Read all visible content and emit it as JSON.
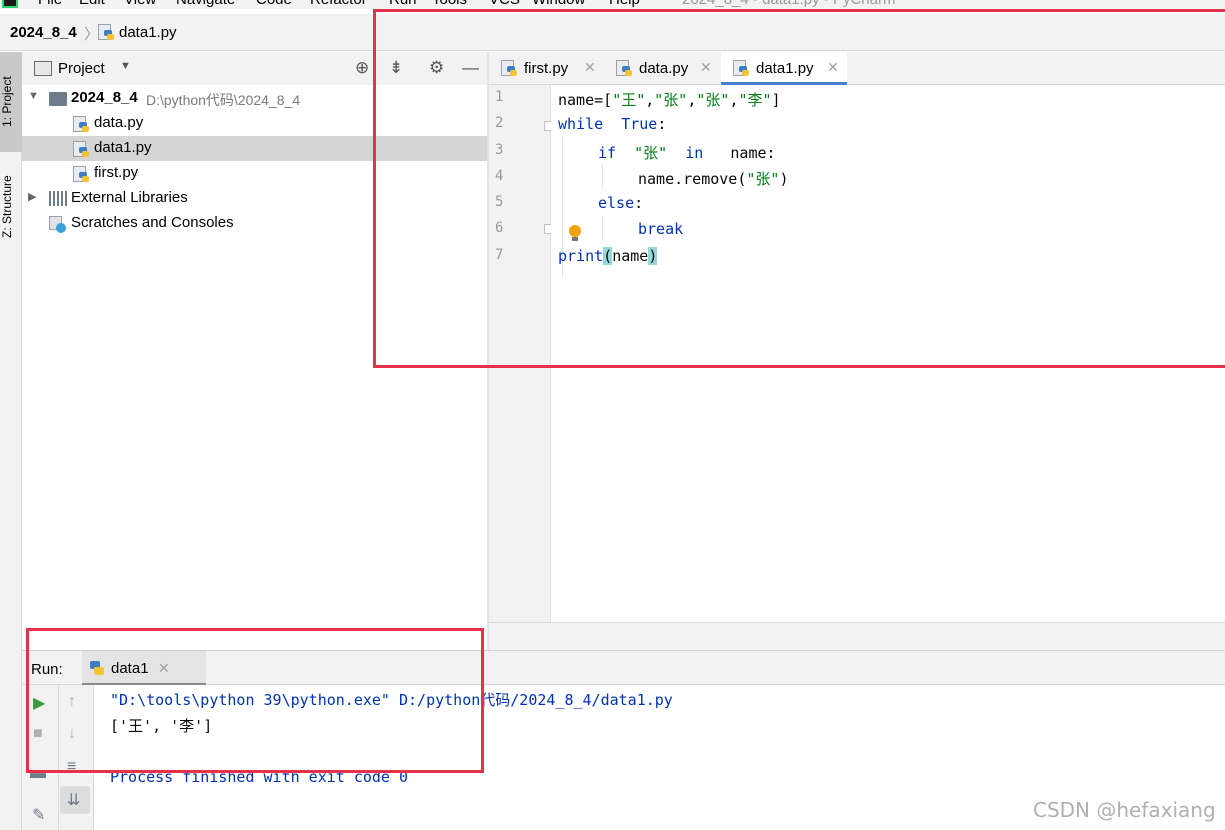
{
  "menu": {
    "items": [
      "File",
      "Edit",
      "View",
      "Navigate",
      "Code",
      "Refactor",
      "Run",
      "Tools",
      "VCS",
      "Window",
      "Help"
    ],
    "window_title": "2024_8_4 - data1.py - PyCharm"
  },
  "breadcrumb": {
    "project": "2024_8_4",
    "file": "data1.py"
  },
  "left_strip": {
    "project_tab": "1: Project",
    "structure_tab": "Z: Structure"
  },
  "project_panel": {
    "title": "Project",
    "root": {
      "name": "2024_8_4",
      "path": "D:\\python代码\\2024_8_4"
    },
    "files": [
      "data.py",
      "data1.py",
      "first.py"
    ],
    "selected_file": "data1.py",
    "external_libraries": "External Libraries",
    "scratches": "Scratches and Consoles"
  },
  "editor": {
    "tabs": [
      {
        "label": "first.py",
        "active": false
      },
      {
        "label": "data.py",
        "active": false
      },
      {
        "label": "data1.py",
        "active": true
      }
    ],
    "line_numbers": [
      "1",
      "2",
      "3",
      "4",
      "5",
      "6",
      "7"
    ],
    "code": {
      "l1_prefix": "name=[",
      "l1_s1": "\"王\"",
      "l1_s2": "\"张\"",
      "l1_s3": "\"张\"",
      "l1_s4": "\"李\"",
      "l1_suffix": "]",
      "comma": ",",
      "l2_kw": "while",
      "l2_true": "True",
      "l2_colon": ":",
      "l3_if": "if",
      "l3_str": "\"张\"",
      "l3_in": "in",
      "l3_rest": "name:",
      "l4_call": "name.remove(",
      "l4_str": "\"张\"",
      "l4_end": ")",
      "l5_else": "else",
      "l5_colon": ":",
      "l6_break": "break",
      "l7_print": "print",
      "l7_open": "(",
      "l7_arg": "name",
      "l7_close": ")"
    }
  },
  "run_panel": {
    "label": "Run:",
    "tab": "data1",
    "output": {
      "command": "\"D:\\tools\\python 39\\python.exe\" D:/python代码/2024_8_4/data1.py",
      "result": "['王', '李']",
      "finished": "Process finished with exit code 0"
    }
  },
  "watermark": "CSDN @hefaxiang",
  "colors": {
    "annotation": "#e8304a",
    "keyword": "#0033b3",
    "string": "#067d17",
    "tab_accent": "#4083c9"
  }
}
